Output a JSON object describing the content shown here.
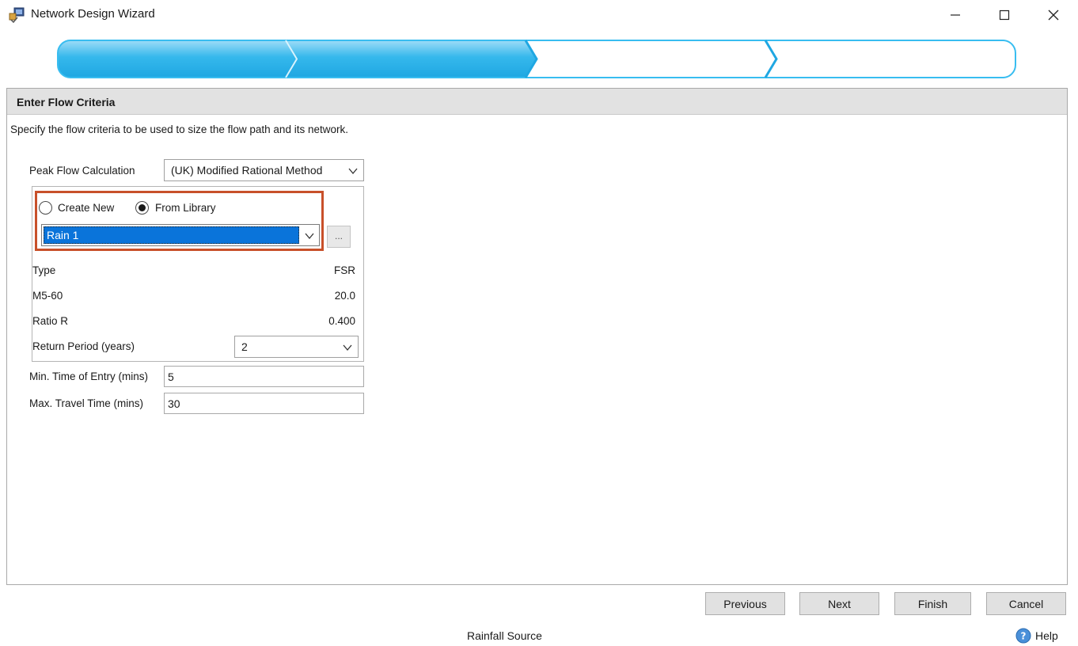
{
  "window": {
    "title": "Network Design Wizard"
  },
  "wizard": {
    "total_steps": 4,
    "completed_steps": 2
  },
  "panel": {
    "header": "Enter Flow Criteria",
    "instructions": "Specify the flow criteria to be used to size the flow path and its network."
  },
  "peak_flow": {
    "label": "Peak Flow Calculation",
    "value": "(UK) Modified Rational Method"
  },
  "source": {
    "create_new_label": "Create New",
    "from_library_label": "From Library",
    "selected_option": "From Library",
    "library_value": "Rain 1",
    "browse_label": "..."
  },
  "properties": {
    "type_label": "Type",
    "type_value": "FSR",
    "m560_label": "M5-60",
    "m560_value": "20.0",
    "ratio_label": "Ratio R",
    "ratio_value": "0.400",
    "return_period_label": "Return Period (years)",
    "return_period_value": "2"
  },
  "times": {
    "min_entry_label": "Min. Time of Entry (mins)",
    "min_entry_value": "5",
    "max_travel_label": "Max. Travel Time (mins)",
    "max_travel_value": "30"
  },
  "buttons": {
    "previous": "Previous",
    "next": "Next",
    "finish": "Finish",
    "cancel": "Cancel"
  },
  "status": {
    "text": "Rainfall Source",
    "help": "Help"
  },
  "colors": {
    "progress_fill": "#2fb4ea",
    "progress_border": "#38bdf0",
    "highlight": "#c8502a",
    "selection": "#0a74da"
  }
}
